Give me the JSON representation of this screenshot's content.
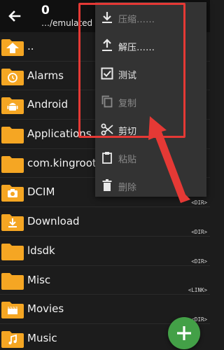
{
  "header": {
    "title": "0",
    "path": "…/emulated"
  },
  "rows": [
    {
      "name": "..",
      "type": "up",
      "tag": ""
    },
    {
      "name": "Alarms",
      "type": "alarm",
      "tag": ""
    },
    {
      "name": "Android",
      "type": "android",
      "tag": ""
    },
    {
      "name": "Applications",
      "type": "plain",
      "tag": ""
    },
    {
      "name": "com.kingroot.k",
      "type": "plain",
      "tag": ""
    },
    {
      "name": "DCIM",
      "type": "camera",
      "tag": "<DIR>"
    },
    {
      "name": "Download",
      "type": "download",
      "tag": "<DIR>"
    },
    {
      "name": "ldsdk",
      "type": "plain",
      "tag": "<DIR>"
    },
    {
      "name": "Misc",
      "type": "plain",
      "tag": "<LINK>"
    },
    {
      "name": "Movies",
      "type": "movie",
      "tag": "<DIR>"
    },
    {
      "name": "Music",
      "type": "music",
      "tag": ""
    }
  ],
  "menu": {
    "items": [
      {
        "label": "压缩……",
        "icon": "download-icon",
        "dim": true
      },
      {
        "label": "解压……",
        "icon": "upload-icon",
        "dim": false
      },
      {
        "label": "测试",
        "icon": "checkbox-icon",
        "dim": false
      },
      {
        "label": "复制",
        "icon": "copy-icon",
        "dim": true
      },
      {
        "label": "剪切",
        "icon": "scissors-icon",
        "dim": false
      },
      {
        "label": "粘贴",
        "icon": "clipboard-icon",
        "dim": true
      },
      {
        "label": "删除",
        "icon": "trash-icon",
        "dim": true
      }
    ]
  },
  "fab": {
    "icon": "plus-icon"
  },
  "colors": {
    "folder": "#f5a623",
    "accent_red": "#e53935",
    "fab": "#43a047",
    "menu_bg": "#333333"
  }
}
